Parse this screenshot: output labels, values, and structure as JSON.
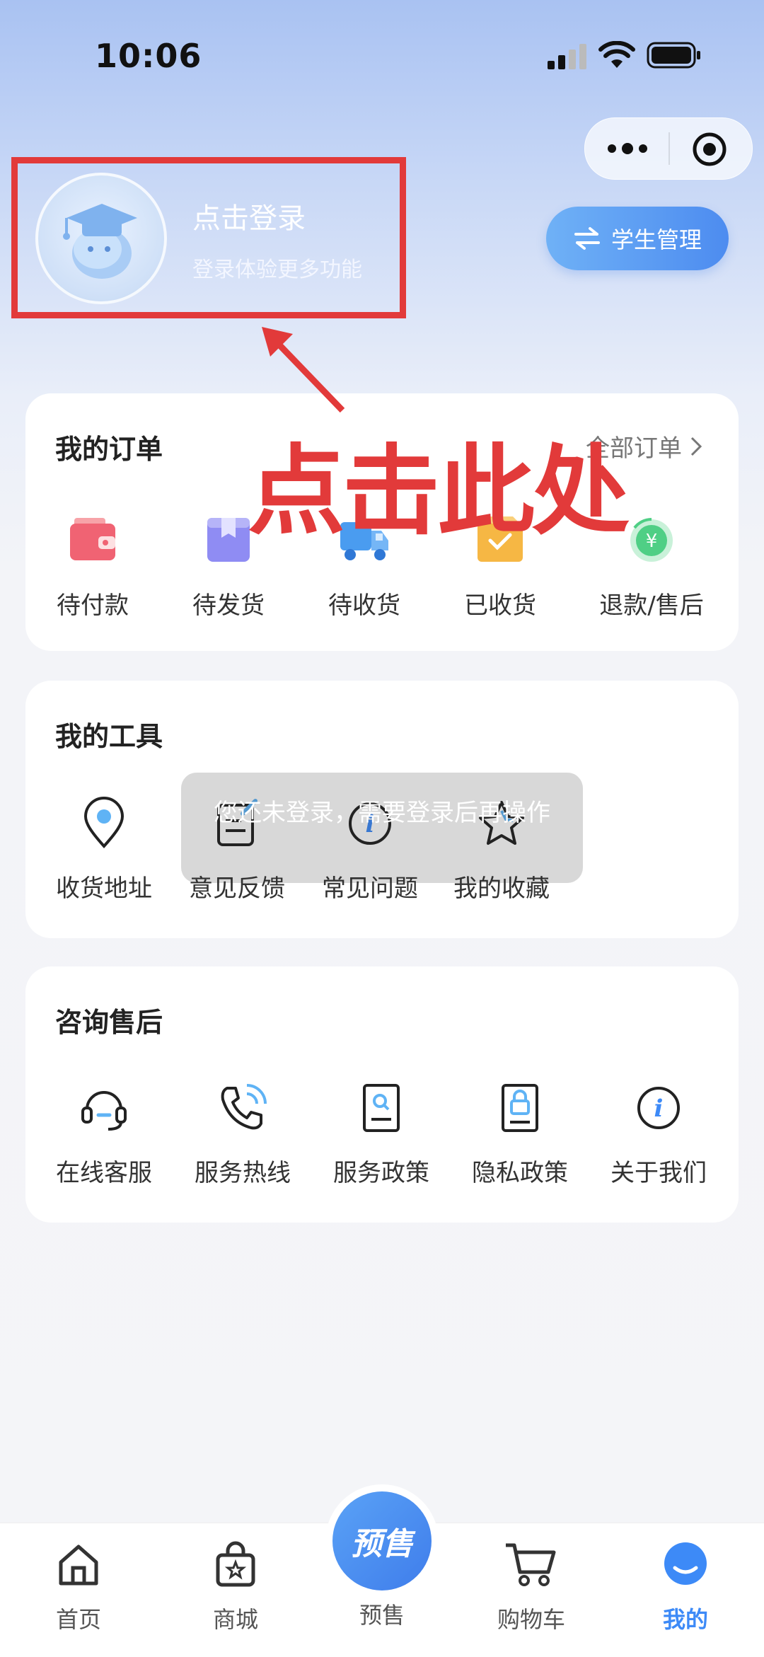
{
  "status_bar": {
    "time": "10:06"
  },
  "header": {
    "student_button": "学生管理",
    "login_title": "点击登录",
    "login_subtitle": "登录体验更多功能"
  },
  "annotation": {
    "text": "点击此处"
  },
  "orders": {
    "title": "我的订单",
    "all_link": "全部订单",
    "items": [
      {
        "label": "待付款",
        "icon": "wallet-icon"
      },
      {
        "label": "待发货",
        "icon": "bookmark-box-icon"
      },
      {
        "label": "待收货",
        "icon": "truck-icon"
      },
      {
        "label": "已收货",
        "icon": "check-box-icon"
      },
      {
        "label": "退款/售后",
        "icon": "refund-icon"
      }
    ]
  },
  "tools": {
    "title": "我的工具",
    "items": [
      {
        "label": "收货地址",
        "icon": "location-pin-icon"
      },
      {
        "label": "意见反馈",
        "icon": "feedback-icon"
      },
      {
        "label": "常见问题",
        "icon": "info-icon"
      },
      {
        "label": "我的收藏",
        "icon": "star-icon"
      }
    ]
  },
  "service": {
    "title": "咨询售后",
    "items": [
      {
        "label": "在线客服",
        "icon": "headset-icon"
      },
      {
        "label": "服务热线",
        "icon": "phone-icon"
      },
      {
        "label": "服务政策",
        "icon": "policy-doc-icon"
      },
      {
        "label": "隐私政策",
        "icon": "lock-doc-icon"
      },
      {
        "label": "关于我们",
        "icon": "about-info-icon"
      }
    ]
  },
  "toast": {
    "text": "您还未登录，需要登录后再操作"
  },
  "tabbar": {
    "items": [
      {
        "label": "首页",
        "icon": "home-icon"
      },
      {
        "label": "商城",
        "icon": "shop-bag-icon"
      },
      {
        "label": "预售",
        "icon": "presale-icon",
        "badge": "预售"
      },
      {
        "label": "购物车",
        "icon": "cart-icon"
      },
      {
        "label": "我的",
        "icon": "profile-icon"
      }
    ],
    "active_color": "#3d8af7"
  },
  "colors": {
    "annotation_red": "#e23a3a",
    "accent_blue": "#4d8cf0"
  }
}
